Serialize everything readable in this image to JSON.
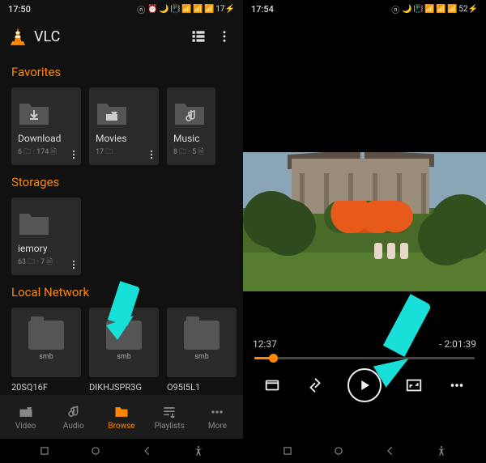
{
  "left": {
    "status_time": "17:50",
    "battery": "17",
    "app_title": "VLC",
    "sections": {
      "favorites": {
        "title": "Favorites",
        "tiles": [
          {
            "label": "Download",
            "sub": "6 🗀 · 174 🗎"
          },
          {
            "label": "Movies",
            "sub": "17 🗀"
          },
          {
            "label": "Music",
            "sub": "8 🗀 · 5 🗎"
          }
        ]
      },
      "storages": {
        "title": "Storages",
        "tiles": [
          {
            "label": "iemory",
            "sub": "63 🗀 · 7 🗎"
          }
        ]
      },
      "local_network": {
        "title": "Local Network",
        "smb_label": "smb",
        "servers": [
          "20SQ16F",
          "DIKHJSPR3G",
          "O95I5L1"
        ]
      }
    },
    "nav": {
      "video": "Video",
      "audio": "Audio",
      "browse": "Browse",
      "playlists": "Playlists",
      "more": "More"
    }
  },
  "right": {
    "status_time": "17:54",
    "battery": "52",
    "elapsed": "12:37",
    "remaining": "- 2:01:39"
  },
  "colors": {
    "accent": "#ff8800",
    "arrow": "#18e0d8"
  }
}
